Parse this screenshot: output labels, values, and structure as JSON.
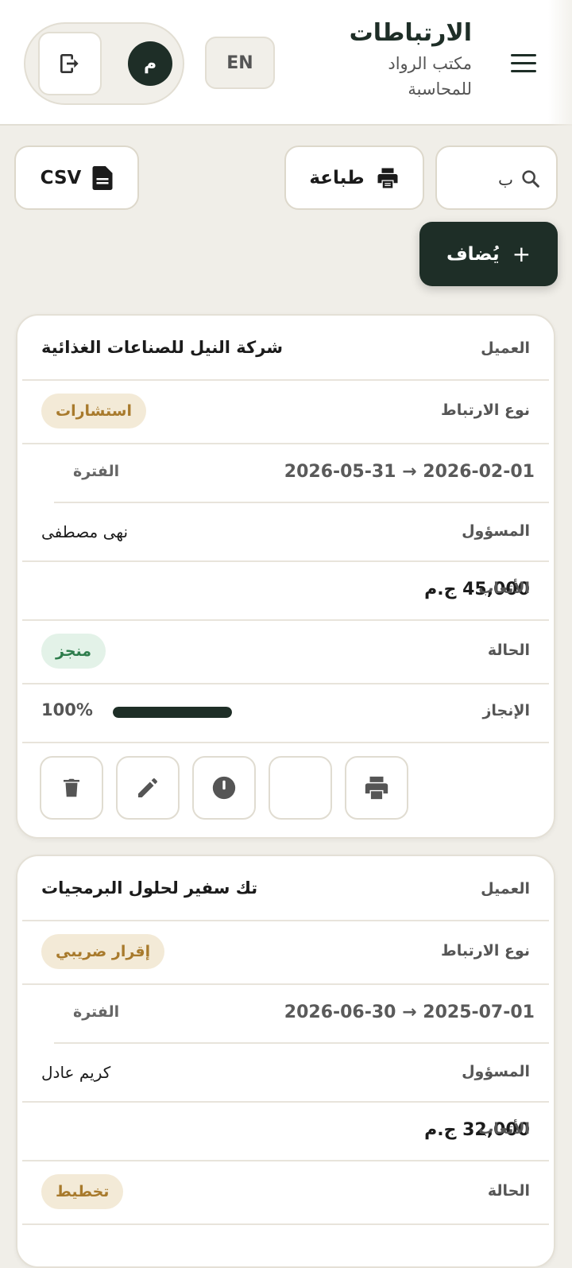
{
  "header": {
    "title": "الارتباطات",
    "subtitle": "مكتب الرواد للمحاسبة",
    "lang_label": "EN",
    "avatar_initial": "م"
  },
  "toolbar": {
    "search_value": "ب",
    "print_label": "طباعة",
    "csv_label": "CSV",
    "add_label": "يُضاف",
    "add_plus": "+"
  },
  "labels": {
    "client": "العميل",
    "engagement_type": "نوع الارتباط",
    "period": "الفترة",
    "owner": "المسؤول",
    "fees": "الأتعاب",
    "status": "الحالة",
    "completion": "الإنجاز"
  },
  "engagements": [
    {
      "client": "شركة النيل للصناعات الغذائية",
      "type": "استشارات",
      "period": "2026-02-01 → 2026-05-31",
      "owner": "نهى مصطفى",
      "fees": "45,000 ج.م",
      "status": "منجز",
      "status_color": "#2e7d4c",
      "progress_text": "100%",
      "progress": 1.0
    },
    {
      "client": "تك سفير لحلول البرمجيات",
      "type": "إقرار ضريبي",
      "period": "2025-07-01 → 2026-06-30",
      "owner": "كريم عادل",
      "fees": "32,000 ج.م",
      "status": "تخطيط",
      "status_color": "#a87a2c"
    }
  ],
  "card_actions": [
    "print-icon",
    "blank",
    "status-icon",
    "edit-icon",
    "delete-icon"
  ],
  "colors": {
    "primary": "#1e2e27",
    "background": "#f0eee8",
    "gold": "#a87a2c",
    "green": "#2e7d4c"
  }
}
